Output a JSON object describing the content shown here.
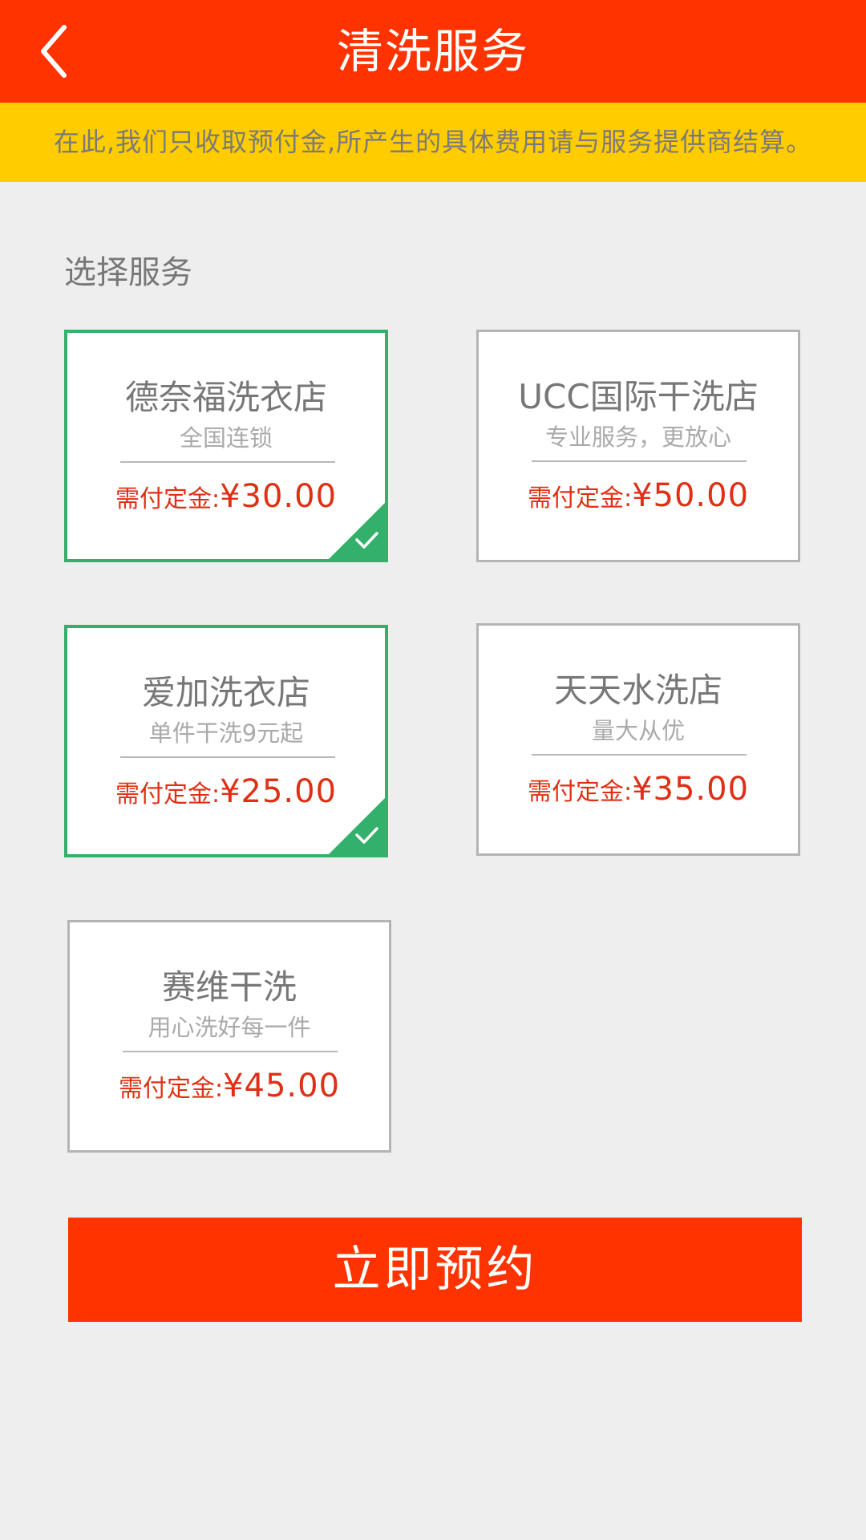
{
  "header": {
    "title": "清洗服务",
    "back_icon": "chevron-left-icon"
  },
  "notice": {
    "text": "在此,我们只收取预付金,所产生的具体费用请与服务提供商结算。"
  },
  "section": {
    "label": "选择服务"
  },
  "services": [
    {
      "name": "德奈福洗衣店",
      "tagline": "全国连锁",
      "price_label": "需付定金:",
      "price_amount": "¥30.00",
      "selected": true
    },
    {
      "name": "UCC国际干洗店",
      "tagline": "专业服务，更放心",
      "price_label": "需付定金:",
      "price_amount": "¥50.00",
      "selected": false
    },
    {
      "name": "爱加洗衣店",
      "tagline": "单件干洗9元起",
      "price_label": "需付定金:",
      "price_amount": "¥25.00",
      "selected": true
    },
    {
      "name": "天天水洗店",
      "tagline": "量大从优",
      "price_label": "需付定金:",
      "price_amount": "¥35.00",
      "selected": false
    },
    {
      "name": "赛维干洗",
      "tagline": "用心洗好每一件",
      "price_label": "需付定金:",
      "price_amount": "¥45.00",
      "selected": false
    }
  ],
  "book_button": {
    "label": "立即预约"
  },
  "colors": {
    "primary": "#ff3300",
    "notice_bg": "#ffcc00",
    "selected_border": "#33b06a",
    "price_text": "#e02f14",
    "background": "#eeeeee"
  }
}
